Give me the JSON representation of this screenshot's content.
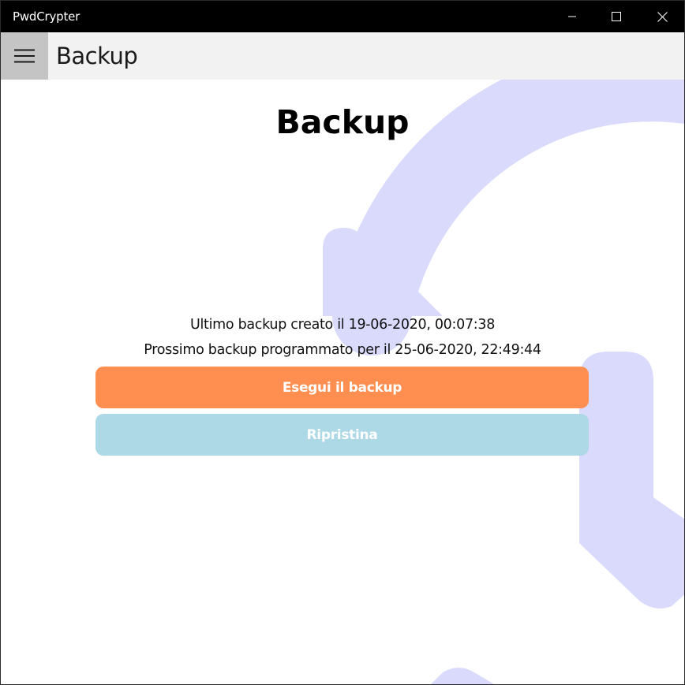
{
  "window": {
    "title": "PwdCrypter",
    "controls": {
      "minimize": "minimize-icon",
      "maximize": "maximize-icon",
      "close": "close-icon"
    }
  },
  "header": {
    "menu_icon": "hamburger-menu-icon",
    "title": "Backup"
  },
  "main": {
    "title": "Backup",
    "last_backup": "Ultimo backup creato il 19-06-2020, 00:07:38",
    "next_backup": "Prossimo backup programmato per il 25-06-2020, 22:49:44",
    "backup_button": "Esegui il backup",
    "restore_button": "Ripristina",
    "background_icon": "backup-history-icon"
  },
  "colors": {
    "titlebar": "#000000",
    "appbar": "#f2f2f2",
    "hamburger_bg": "#c4c4c4",
    "backup_button": "#ff8f50",
    "restore_button": "#add8e6",
    "background_art": "#dadafd"
  }
}
